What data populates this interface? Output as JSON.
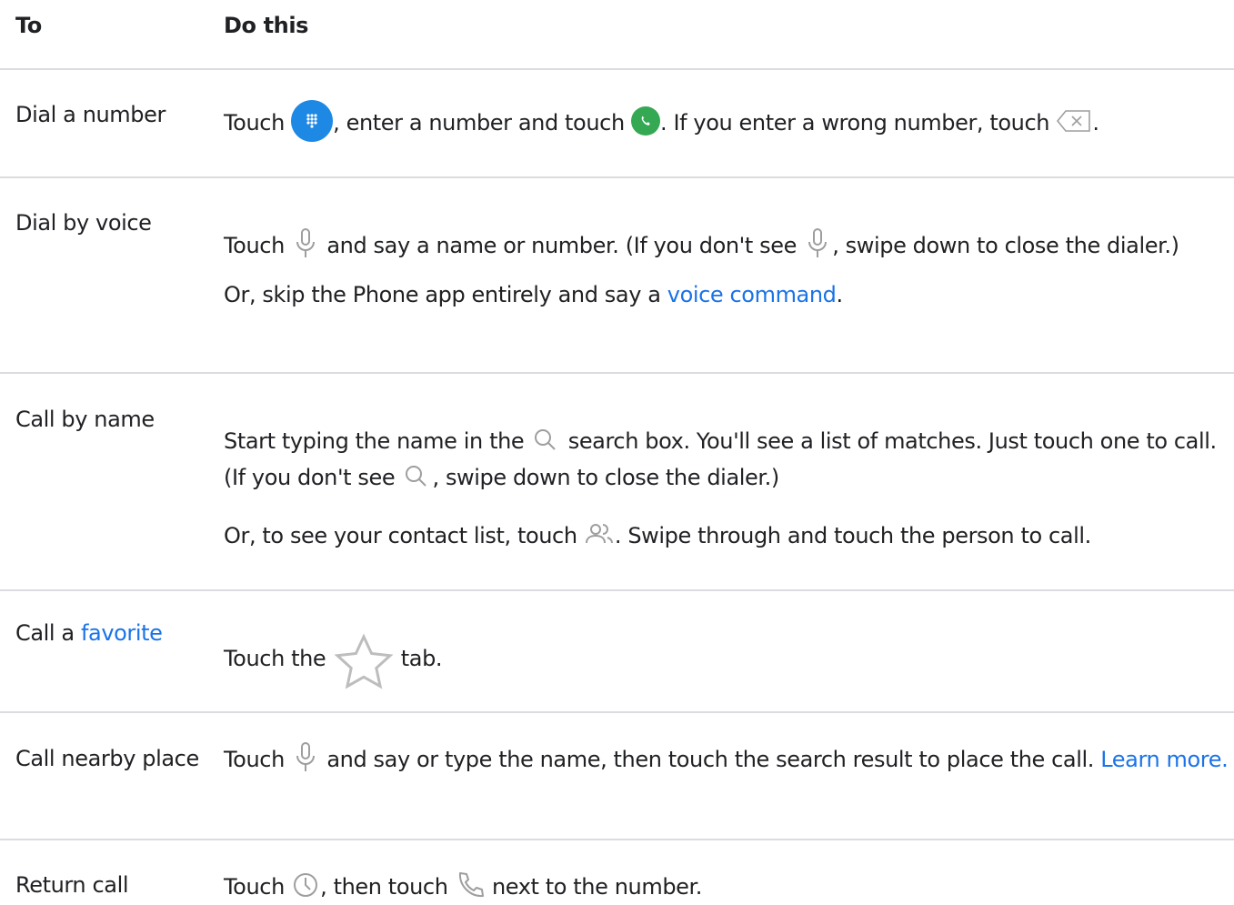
{
  "header": {
    "col_to": "To",
    "col_do": "Do this"
  },
  "rows": [
    {
      "to": "Dial a number",
      "do": {
        "t1": "Touch ",
        "t2": ", enter a number and touch ",
        "t3": ". If you enter a wrong number, touch ",
        "t4": "."
      }
    },
    {
      "to": "Dial by voice",
      "do": {
        "t1": "Touch ",
        "t2": " and say a name or number. (If you don't see ",
        "t3": ", swipe down to close the dialer.)",
        "p2a": "Or, skip the Phone app entirely and say a ",
        "link": "voice command",
        "p2b": "."
      }
    },
    {
      "to": "Call by name",
      "do": {
        "t1": "Start typing the name in the ",
        "t2": " search box. You'll see a list of matches. Just touch one to call. (If you don't see ",
        "t3": ", swipe down to close the dialer.)",
        "p2a": "Or, to see your contact list, touch ",
        "p2b": ". Swipe through and touch the person to call."
      }
    },
    {
      "to_prefix": "Call a ",
      "to_link": "favorite",
      "do": {
        "t1": "Touch the ",
        "t2": " tab."
      }
    },
    {
      "to": "Call nearby place",
      "do": {
        "t1": "Touch ",
        "t2": " and say or type the name, then touch the search result to place the call. ",
        "link": "Learn more."
      }
    },
    {
      "to": "Return call",
      "do": {
        "t1": "Touch ",
        "t2": ", then touch ",
        "t3": " next to the number."
      }
    }
  ],
  "icons": {
    "dialpad": "dialpad-icon",
    "call": "call-icon",
    "backspace": "backspace-icon",
    "mic": "mic-icon",
    "search": "search-icon",
    "contacts": "contacts-icon",
    "favorite": "star-icon",
    "recents": "clock-icon",
    "phone": "phone-icon"
  },
  "colors": {
    "link": "#1a73e8",
    "dialpad": "#1e88e5",
    "call": "#34a853",
    "divider": "#dadce0",
    "icon_gray": "#9e9e9e"
  }
}
